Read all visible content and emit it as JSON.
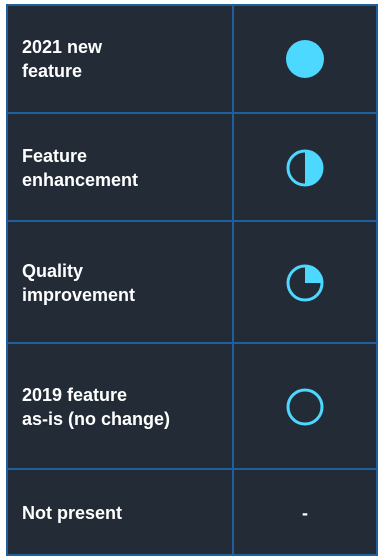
{
  "legend": {
    "rows": [
      {
        "label": "2021 new\nfeature",
        "icon": "full-circle-icon"
      },
      {
        "label": "Feature\nenhancement",
        "icon": "half-circle-icon"
      },
      {
        "label": "Quality\nimprovement",
        "icon": "quarter-circle-icon"
      },
      {
        "label": "2019 feature\nas-is (no change)",
        "icon": "empty-circle-icon"
      },
      {
        "label": "Not present",
        "icon": "dash",
        "symbol": "-"
      }
    ],
    "colors": {
      "background": "#222b36",
      "border": "#1f5f9e",
      "icon": "#4dd8ff",
      "text": "#ffffff"
    }
  }
}
